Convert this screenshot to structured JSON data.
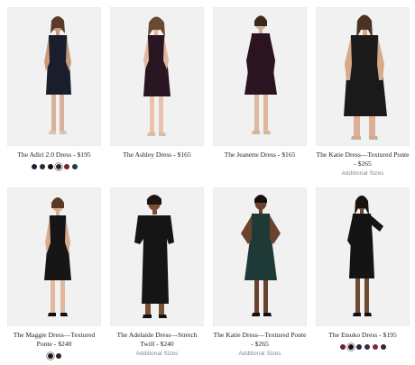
{
  "products": [
    {
      "name": "The Adiri 2.0 Dress - $195",
      "extra": "",
      "dress_color": "#1a1d2c",
      "swatches": [
        "#1b2238",
        "#2b2b2b",
        "#14141a",
        "#3a1f28",
        "#7a1f2a",
        "#1f3a40"
      ]
    },
    {
      "name": "The Ashley Dress - $165",
      "extra": "",
      "dress_color": "#2a1622",
      "swatches": []
    },
    {
      "name": "The Jeanette Dress - $165",
      "extra": "",
      "dress_color": "#2b1420",
      "swatches": []
    },
    {
      "name": "The Katie Dress—Textured Ponte - $265",
      "extra": "Additional Sizes",
      "dress_color": "#1a1a1a",
      "swatches": []
    },
    {
      "name": "The Maggie Dress—Textured Ponte - $240",
      "extra": "",
      "dress_color": "#161616",
      "swatches": [
        "#1a1a1a",
        "#3a1f26"
      ]
    },
    {
      "name": "The Adelaide Dress—Stretch Twill - $240",
      "extra": "Additional Sizes",
      "dress_color": "#151515",
      "swatches": []
    },
    {
      "name": "The Katie Dress—Textured Ponte - $265",
      "extra": "Additional Sizes",
      "dress_color": "#1f3a36",
      "swatches": []
    },
    {
      "name": "The Etsuko Dress - $195",
      "extra": "",
      "dress_color": "#141414",
      "swatches": [
        "#6b2233",
        "#141414",
        "#1e2a45",
        "#3a2a50",
        "#7a2b3e",
        "#4a1f2f"
      ]
    }
  ]
}
